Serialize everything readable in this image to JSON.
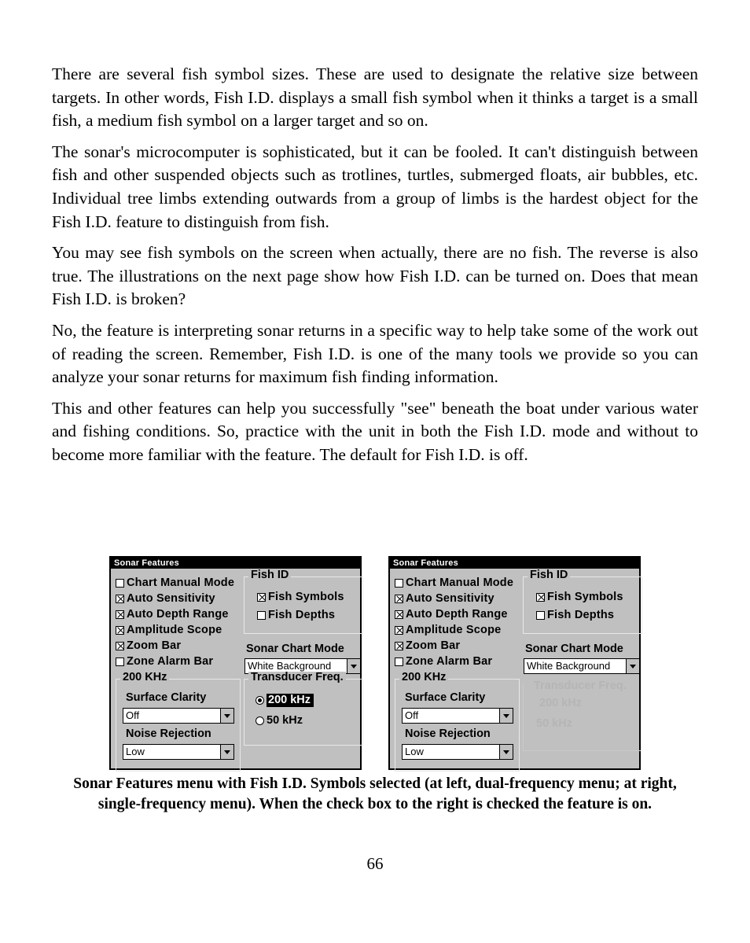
{
  "document": {
    "page_number": "66",
    "paragraphs": [
      "There are several fish symbol sizes. These are used to designate the relative size between targets. In other words, Fish I.D. displays a small fish symbol when it thinks a target is a small fish, a medium fish symbol on a larger target and so on.",
      "The sonar's microcomputer is sophisticated, but it can be fooled. It can't distinguish between fish and other suspended objects such as trotlines, turtles, submerged floats, air bubbles, etc. Individual tree limbs extending outwards from a group of limbs is the hardest object for the Fish I.D. feature to distinguish from fish.",
      "You may see fish symbols on the screen when actually, there are no fish. The reverse is also true. The illustrations on the next page show how Fish I.D. can be turned on. Does that mean Fish I.D. is broken?",
      "No, the feature is interpreting sonar returns in a specific way to help take some of the work out of reading the screen. Remember, Fish I.D. is one of the many tools we provide so you can analyze your sonar returns for maximum fish finding information.",
      "This and other features can help you successfully \"see\" beneath the boat under various water and fishing conditions. So, practice with the unit in both the Fish I.D. mode and without to become more familiar with the feature. The default for Fish I.D. is off."
    ],
    "figure_caption": "Sonar Features menu with Fish I.D. Symbols selected (at left, dual-frequency menu; at right, single-frequency menu). When the check box to the right is checked the feature is on."
  },
  "colors": {
    "dialog_face": "#c0c0c0",
    "titlebar_bg": "#000000",
    "titlebar_fg": "#ffffff",
    "field_bg": "#ffffff",
    "border": "#000000",
    "ghost": "#b5b5b5"
  },
  "dialog_left": {
    "title": "Sonar Features",
    "checkboxes": [
      {
        "label": "Chart Manual Mode",
        "checked": false
      },
      {
        "label": "Auto Sensitivity",
        "checked": true
      },
      {
        "label": "Auto Depth Range",
        "checked": true
      },
      {
        "label": "Amplitude Scope",
        "checked": true
      },
      {
        "label": "Zoom Bar",
        "checked": true
      },
      {
        "label": "Zone Alarm Bar",
        "checked": false
      }
    ],
    "khz_group": {
      "title": "200 KHz",
      "surface_clarity_label": "Surface Clarity",
      "surface_clarity_value": "Off",
      "noise_rejection_label": "Noise Rejection",
      "noise_rejection_value": "Low"
    },
    "fish_id_group": {
      "title": "Fish ID",
      "items": [
        {
          "label": "Fish Symbols",
          "checked": true
        },
        {
          "label": "Fish Depths",
          "checked": false
        }
      ]
    },
    "sonar_chart_mode": {
      "label": "Sonar Chart Mode",
      "value": "White Background"
    },
    "transducer_freq": {
      "title": "Transducer Freq.",
      "options": [
        {
          "label": "200 kHz",
          "selected": true
        },
        {
          "label": "50 kHz",
          "selected": false
        }
      ]
    }
  },
  "dialog_right": {
    "title": "Sonar Features",
    "checkboxes": [
      {
        "label": "Chart Manual Mode",
        "checked": false
      },
      {
        "label": "Auto Sensitivity",
        "checked": true
      },
      {
        "label": "Auto Depth Range",
        "checked": true
      },
      {
        "label": "Amplitude Scope",
        "checked": true
      },
      {
        "label": "Zoom Bar",
        "checked": true
      },
      {
        "label": "Zone Alarm Bar",
        "checked": false
      }
    ],
    "khz_group": {
      "title": "200 KHz",
      "surface_clarity_label": "Surface Clarity",
      "surface_clarity_value": "Off",
      "noise_rejection_label": "Noise Rejection",
      "noise_rejection_value": "Low"
    },
    "fish_id_group": {
      "title": "Fish ID",
      "items": [
        {
          "label": "Fish Symbols",
          "checked": true
        },
        {
          "label": "Fish Depths",
          "checked": false
        }
      ]
    },
    "sonar_chart_mode": {
      "label": "Sonar Chart Mode",
      "value": "White Background"
    },
    "ghost_remnants": {
      "title": "Transducer Freq.",
      "option_one": "200 kHz",
      "option_two": "50 kHz"
    }
  }
}
